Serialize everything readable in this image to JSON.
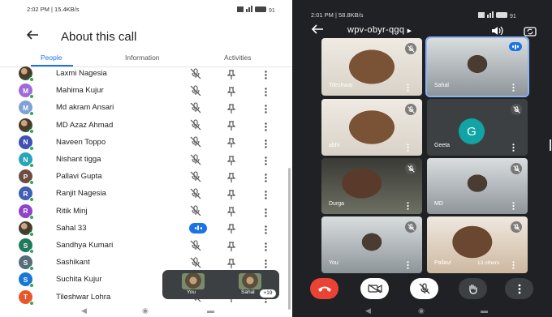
{
  "left": {
    "status_time": "2:02 PM | 15.4KB/s",
    "status_battery": "91",
    "title": "About this call",
    "tabs": [
      "People",
      "Information",
      "Activities"
    ],
    "participants": [
      {
        "name": "Laxmi Nagesia",
        "initial": "",
        "color": "#7c6a5a",
        "photo": true,
        "speaking": false
      },
      {
        "name": "Mahima Kujur",
        "initial": "M",
        "color": "#9e6bd8",
        "photo": false,
        "speaking": false
      },
      {
        "name": "Md akram Ansari",
        "initial": "M",
        "color": "#7fa2d6",
        "photo": false,
        "speaking": false
      },
      {
        "name": "MD Azaz Ahmad",
        "initial": "",
        "color": "#4a6a8a",
        "photo": true,
        "speaking": false
      },
      {
        "name": "Naveen Toppo",
        "initial": "N",
        "color": "#3f51b5",
        "photo": false,
        "speaking": false
      },
      {
        "name": "Nishant tigga",
        "initial": "N",
        "color": "#26a6b8",
        "photo": false,
        "speaking": false
      },
      {
        "name": "Pallavi Gupta",
        "initial": "P",
        "color": "#6d4c41",
        "photo": false,
        "speaking": false
      },
      {
        "name": "Ranjit Nagesia",
        "initial": "R",
        "color": "#3f5fb5",
        "photo": false,
        "speaking": false
      },
      {
        "name": "Ritik Minj",
        "initial": "R",
        "color": "#8e44c8",
        "photo": false,
        "speaking": false
      },
      {
        "name": "Sahal 33",
        "initial": "",
        "color": "#3d5a3a",
        "photo": true,
        "speaking": true
      },
      {
        "name": "Sandhya Kumari",
        "initial": "S",
        "color": "#1e7a5a",
        "photo": false,
        "speaking": false
      },
      {
        "name": "Sashikant",
        "initial": "S",
        "color": "#546e7a",
        "photo": false,
        "speaking": false
      },
      {
        "name": "Suchita Kujur",
        "initial": "S",
        "color": "#1976d2",
        "photo": false,
        "speaking": false
      },
      {
        "name": "Tileshwar Lohra",
        "initial": "T",
        "color": "#e8572a",
        "photo": false,
        "speaking": false
      }
    ],
    "float_labels": [
      "You",
      "Sahal"
    ],
    "float_badge": "+19"
  },
  "right": {
    "status_time": "2:01 PM | 58.8KB/s",
    "status_battery": "91",
    "meeting_code": "wpv-obyr-qgq",
    "tiles": [
      {
        "name": "Tileshwar",
        "kind": "photo-face",
        "speaking": false
      },
      {
        "name": "Sahal",
        "kind": "photo-small",
        "speaking": true
      },
      {
        "name": "abhi",
        "kind": "photo-face",
        "speaking": false
      },
      {
        "name": "Geeta",
        "kind": "avatar",
        "initial": "G",
        "speaking": false
      },
      {
        "name": "Durga",
        "kind": "photo-dark",
        "speaking": false
      },
      {
        "name": "MD",
        "kind": "photo-small",
        "speaking": false
      },
      {
        "name": "You",
        "kind": "photo-small",
        "speaking": false
      },
      {
        "name": "Pallavi",
        "kind": "photo-face2",
        "speaking": false,
        "extra": "13 others"
      }
    ],
    "controls": [
      "end-call",
      "camera-off",
      "mic-off",
      "raise-hand",
      "more"
    ]
  }
}
